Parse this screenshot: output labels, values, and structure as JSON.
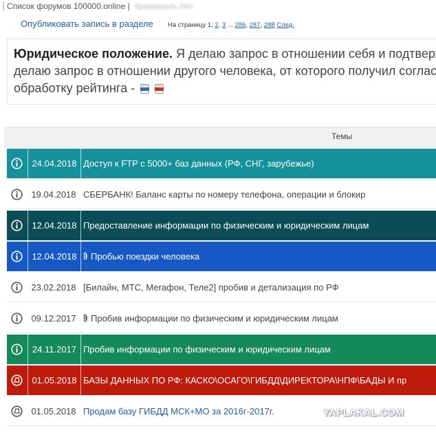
{
  "header": {
    "breadcrumb": "Список форумов 100000.online |",
    "breadcrumb_blurred": "Криминаль.Нет"
  },
  "toolbar": {
    "publish_label": "Опубликовать запись в разделе"
  },
  "pager": {
    "prefix": "На страницу",
    "current": "1",
    "p2": "2",
    "p3": "3",
    "dots": "...",
    "p286": "286",
    "p287": "287",
    "p288": "288",
    "next": "След."
  },
  "description": {
    "heading": "Юридическое положение.",
    "text": "Я делаю запрос в отношении себя и подтверждаю или делаю запрос в отношении другого человека, от которого получил согласие на обработку рейтинга -"
  },
  "table": {
    "header": "Темы",
    "rows": [
      {
        "date": "24.04.2018",
        "title": "Доступ к FTP с 5000+ баз данных (РФ, СНГ, зарубежье)",
        "bg": "#14919b",
        "icon": "info-icon",
        "attach": false,
        "style": "color"
      },
      {
        "date": "19.04.2018",
        "title": "СБЕРБАНК! Баланс карты по номеру телефона, операции и блокир",
        "bg": "#ffffff",
        "icon": "info-icon",
        "attach": false,
        "style": "plain"
      },
      {
        "date": "12.04.2018",
        "title": "Предоставление информации по физическим и юридическим лицам",
        "bg": "#0b4d56",
        "icon": "info-icon",
        "attach": false,
        "style": "color"
      },
      {
        "date": "12.04.2018",
        "title": "Пробью поездки человека",
        "bg": "#1659c4",
        "icon": "info-icon",
        "attach": true,
        "style": "color"
      },
      {
        "date": "23.02.2018",
        "title": "[Билайн, МТС, Мегафон, Теле2] пробив и детализация по РФ",
        "bg": "#ffffff",
        "icon": "info-icon",
        "attach": false,
        "style": "plain"
      },
      {
        "date": "09.12.2017",
        "title": "Пробив информации по физическим и юридическим лицам",
        "bg": "#ffffff",
        "icon": "info-icon",
        "attach": true,
        "style": "plain"
      },
      {
        "date": "24.11.2017",
        "title": "Пробив информации по физическим и юридическим лицам",
        "bg": "#148a5b",
        "icon": "info-icon",
        "attach": false,
        "style": "color"
      },
      {
        "date": "01.05.2018",
        "title": "БАЗЫ ДАННЫХ ПО РФ: КАСКО\\ОСАГО\\ГИБДД\\ДИРЕКТОРА\\НПФ\\БАДЫ И пр",
        "bg": "#bf1b0c",
        "icon": "announcement-icon",
        "attach": false,
        "style": "color"
      },
      {
        "date": "01.05.2018",
        "title": "Продам базу ГИБДД МСК+МО за 2016г-2017г.",
        "bg": "#ffffff",
        "icon": "announcement-icon",
        "attach": false,
        "style": "link"
      }
    ]
  },
  "watermark": "YAPLAKAL.COM",
  "colors": {
    "link": "#1f5fa8",
    "row_border": "#e2e2e2"
  }
}
